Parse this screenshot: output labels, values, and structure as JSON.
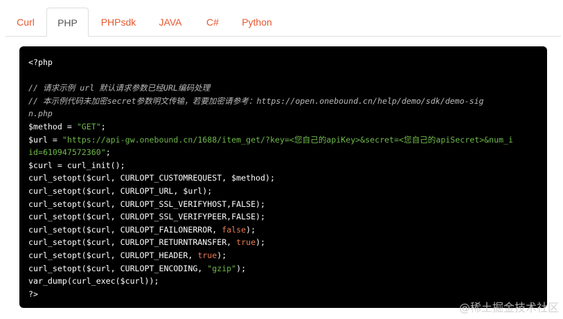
{
  "tabs": [
    {
      "label": "Curl",
      "active": false
    },
    {
      "label": "PHP",
      "active": true
    },
    {
      "label": "PHPsdk",
      "active": false
    },
    {
      "label": "JAVA",
      "active": false
    },
    {
      "label": "C#",
      "active": false
    },
    {
      "label": "Python",
      "active": false
    }
  ],
  "colors": {
    "tab_link": "#e4572e",
    "tab_active": "#555555",
    "code_bg": "#000000",
    "comment": "#b9b9b9",
    "string": "#6fb94a",
    "keyword": "#e87a53"
  },
  "code": {
    "lines": [
      [
        {
          "t": "<?php",
          "c": ""
        }
      ],
      [
        {
          "t": "",
          "c": ""
        }
      ],
      [
        {
          "t": "// 请求示例 url 默认请求参数已经URL编码处理",
          "c": "cmt"
        }
      ],
      [
        {
          "t": "// 本示例代码未加密secret参数明文传输，若要加密请参考：https://open.onebound.cn/help/demo/sdk/demo-sig",
          "c": "cmt"
        }
      ],
      [
        {
          "t": "n.php",
          "c": "cmt"
        }
      ],
      [
        {
          "t": "$method = ",
          "c": ""
        },
        {
          "t": "\"GET\"",
          "c": "str"
        },
        {
          "t": ";",
          "c": ""
        }
      ],
      [
        {
          "t": "$url = ",
          "c": ""
        },
        {
          "t": "\"https://api-gw.onebound.cn/1688/item_get/?key=<您自己的apiKey>&secret=<您自己的apiSecret>&num_i",
          "c": "str"
        }
      ],
      [
        {
          "t": "id=610947572360\"",
          "c": "str"
        },
        {
          "t": ";",
          "c": ""
        }
      ],
      [
        {
          "t": "$curl = curl_init();",
          "c": ""
        }
      ],
      [
        {
          "t": "curl_setopt($curl, CURLOPT_CUSTOMREQUEST, $method);",
          "c": ""
        }
      ],
      [
        {
          "t": "curl_setopt($curl, CURLOPT_URL, $url);",
          "c": ""
        }
      ],
      [
        {
          "t": "curl_setopt($curl, CURLOPT_SSL_VERIFYHOST,FALSE);",
          "c": ""
        }
      ],
      [
        {
          "t": "curl_setopt($curl, CURLOPT_SSL_VERIFYPEER,FALSE);",
          "c": ""
        }
      ],
      [
        {
          "t": "curl_setopt($curl, CURLOPT_FAILONERROR, ",
          "c": ""
        },
        {
          "t": "false",
          "c": "kw"
        },
        {
          "t": ");",
          "c": ""
        }
      ],
      [
        {
          "t": "curl_setopt($curl, CURLOPT_RETURNTRANSFER, ",
          "c": ""
        },
        {
          "t": "true",
          "c": "kw"
        },
        {
          "t": ");",
          "c": ""
        }
      ],
      [
        {
          "t": "curl_setopt($curl, CURLOPT_HEADER, ",
          "c": ""
        },
        {
          "t": "true",
          "c": "kw"
        },
        {
          "t": ");",
          "c": ""
        }
      ],
      [
        {
          "t": "curl_setopt($curl, CURLOPT_ENCODING, ",
          "c": ""
        },
        {
          "t": "\"gzip\"",
          "c": "str"
        },
        {
          "t": ");",
          "c": ""
        }
      ],
      [
        {
          "t": "var_dump(curl_exec($curl));",
          "c": ""
        }
      ],
      [
        {
          "t": "?>",
          "c": ""
        }
      ]
    ]
  },
  "watermark": "@稀土掘金技术社区"
}
